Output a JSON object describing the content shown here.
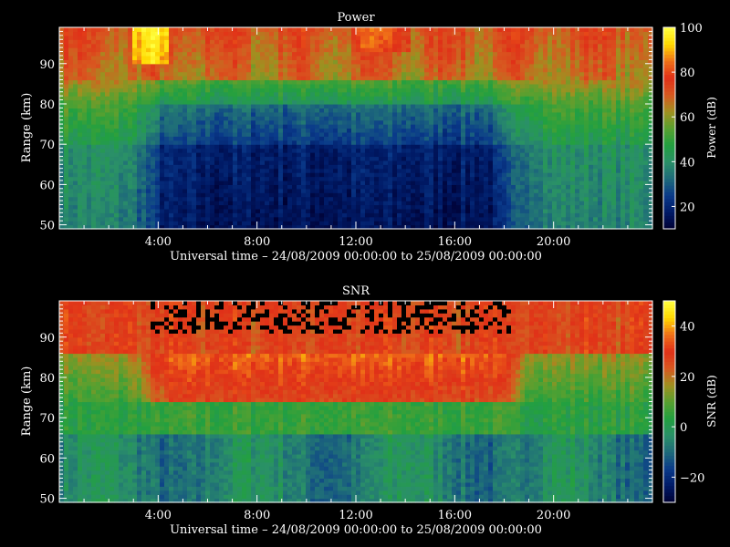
{
  "time_axis": {
    "label": "Universal time – 24/08/2009 00:00:00 to 25/08/2009 00:00:00",
    "range_hours": [
      0,
      24
    ],
    "ticks": [
      {
        "hour": 4,
        "label": "4:00"
      },
      {
        "hour": 8,
        "label": "8:00"
      },
      {
        "hour": 12,
        "label": "12:00"
      },
      {
        "hour": 16,
        "label": "16:00"
      },
      {
        "hour": 20,
        "label": "20:00"
      }
    ]
  },
  "colormap": [
    "#000033",
    "#001a66",
    "#0a3a8a",
    "#1e6a7a",
    "#2a9068",
    "#22a040",
    "#58a030",
    "#a09020",
    "#d85820",
    "#e03018",
    "#f07018",
    "#ffd800",
    "#ffff40"
  ],
  "chart_data": [
    {
      "type": "heatmap",
      "title": "Power",
      "ylabel": "Range (km)",
      "ylim": [
        49,
        99
      ],
      "y_ticks": [
        50,
        60,
        70,
        80,
        90
      ],
      "colorbar": {
        "label": "Power (dB)",
        "range": [
          10,
          100
        ],
        "ticks": [
          20,
          40,
          60,
          80,
          100
        ]
      },
      "model": "power"
    },
    {
      "type": "heatmap",
      "title": "SNR",
      "ylabel": "Range (km)",
      "ylim": [
        49,
        99
      ],
      "y_ticks": [
        50,
        60,
        70,
        80,
        90
      ],
      "colorbar": {
        "label": "SNR (dB)",
        "range": [
          -30,
          50
        ],
        "ticks": [
          -20,
          0,
          20,
          40
        ]
      },
      "model": "snr"
    }
  ]
}
